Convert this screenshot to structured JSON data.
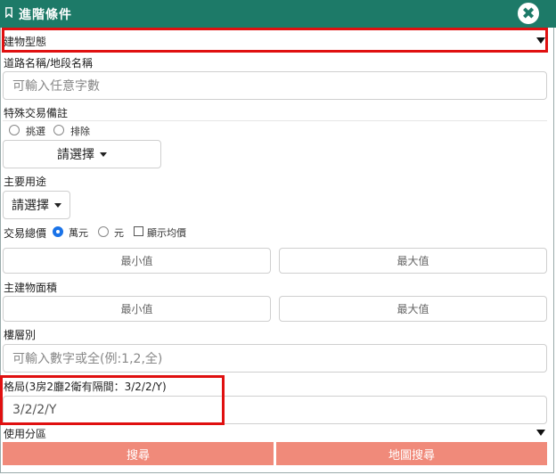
{
  "header": {
    "title": "進階條件",
    "bookmark_icon": "bookmark-icon",
    "close_icon": "close-icon"
  },
  "building_type": {
    "label": "建物型態"
  },
  "road": {
    "label": "道路名稱/地段名稱",
    "placeholder": "可輸入任意字數"
  },
  "special": {
    "label": "特殊交易備註",
    "options": [
      "挑選",
      "排除"
    ],
    "button": "請選擇"
  },
  "usage": {
    "label": "主要用途",
    "button": "請選擇"
  },
  "price": {
    "label": "交易總價",
    "options": [
      "萬元",
      "元"
    ],
    "selected": "萬元",
    "checkbox": "顯示均價",
    "min": "最小值",
    "max": "最大值"
  },
  "area": {
    "label": "主建物面積",
    "min": "最小值",
    "max": "最大值"
  },
  "floor": {
    "label": "樓層別",
    "placeholder": "可輸入數字或全(例:1,2,全)"
  },
  "layout": {
    "label": "格局(3房2廳2衛有隔間：3/2/2/Y)",
    "value": "3/2/2/Y"
  },
  "zoning": {
    "label": "使用分區"
  },
  "actions": {
    "search": "搜尋",
    "map_search": "地圖搜尋"
  },
  "colors": {
    "header": "#1d7a68",
    "highlight": "#e01010",
    "button": "#f08a7a",
    "radio_selected": "#1a73e8"
  }
}
